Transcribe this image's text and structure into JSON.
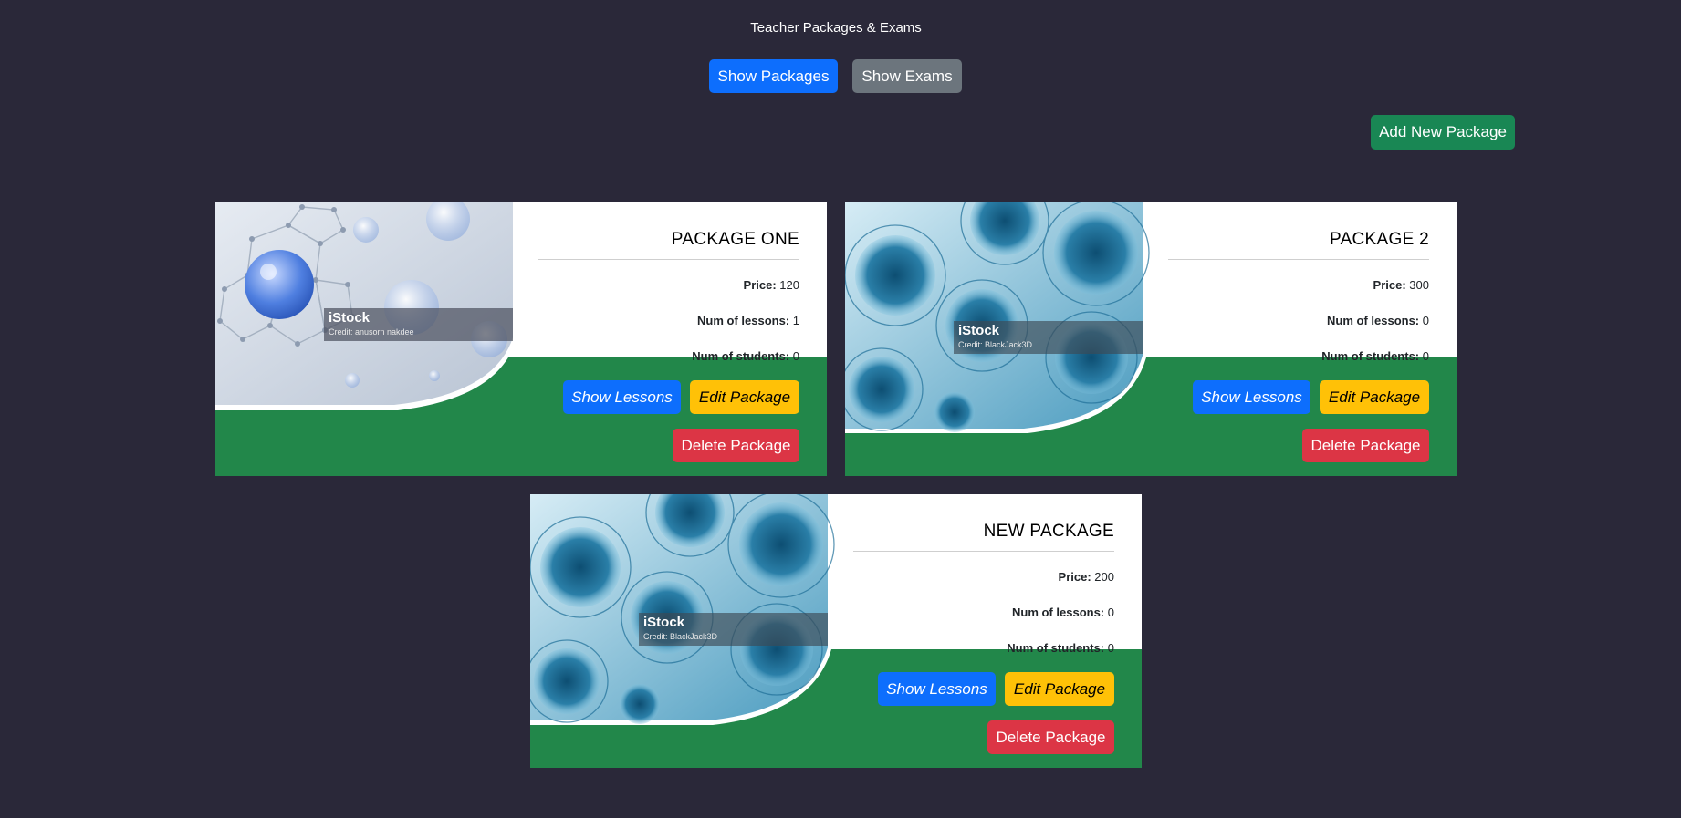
{
  "page": {
    "title": "Teacher Packages & Exams"
  },
  "toolbar": {
    "show_packages_label": "Show Packages",
    "show_exams_label": "Show Exams",
    "add_package_label": "Add New Package"
  },
  "packages": [
    {
      "title": "PACKAGE ONE",
      "price_label": "Price:",
      "price": "120",
      "lessons_label": "Num of lessons:",
      "lessons": "1",
      "students_label": "Num of students:",
      "students": "0",
      "image_brand": "iStock",
      "image_credit": "Credit: anusorn nakdee",
      "show_lessons_label": "Show Lessons",
      "edit_label": "Edit Package",
      "delete_label": "Delete Package"
    },
    {
      "title": "PACKAGE 2",
      "price_label": "Price:",
      "price": "300",
      "lessons_label": "Num of lessons:",
      "lessons": "0",
      "students_label": "Num of students:",
      "students": "0",
      "image_brand": "iStock",
      "image_credit": "Credit: BlackJack3D",
      "show_lessons_label": "Show Lessons",
      "edit_label": "Edit Package",
      "delete_label": "Delete Package"
    },
    {
      "title": "NEW PACKAGE",
      "price_label": "Price:",
      "price": "200",
      "lessons_label": "Num of lessons:",
      "lessons": "0",
      "students_label": "Num of students:",
      "students": "0",
      "image_brand": "iStock",
      "image_credit": "Credit: BlackJack3D",
      "show_lessons_label": "Show Lessons",
      "edit_label": "Edit Package",
      "delete_label": "Delete Package"
    }
  ],
  "colors": {
    "background": "#2a2839",
    "primary": "#0d6efd",
    "secondary": "#6c757d",
    "success": "#198754",
    "warning": "#ffc107",
    "danger": "#dc3545",
    "card_band": "#22874a"
  }
}
